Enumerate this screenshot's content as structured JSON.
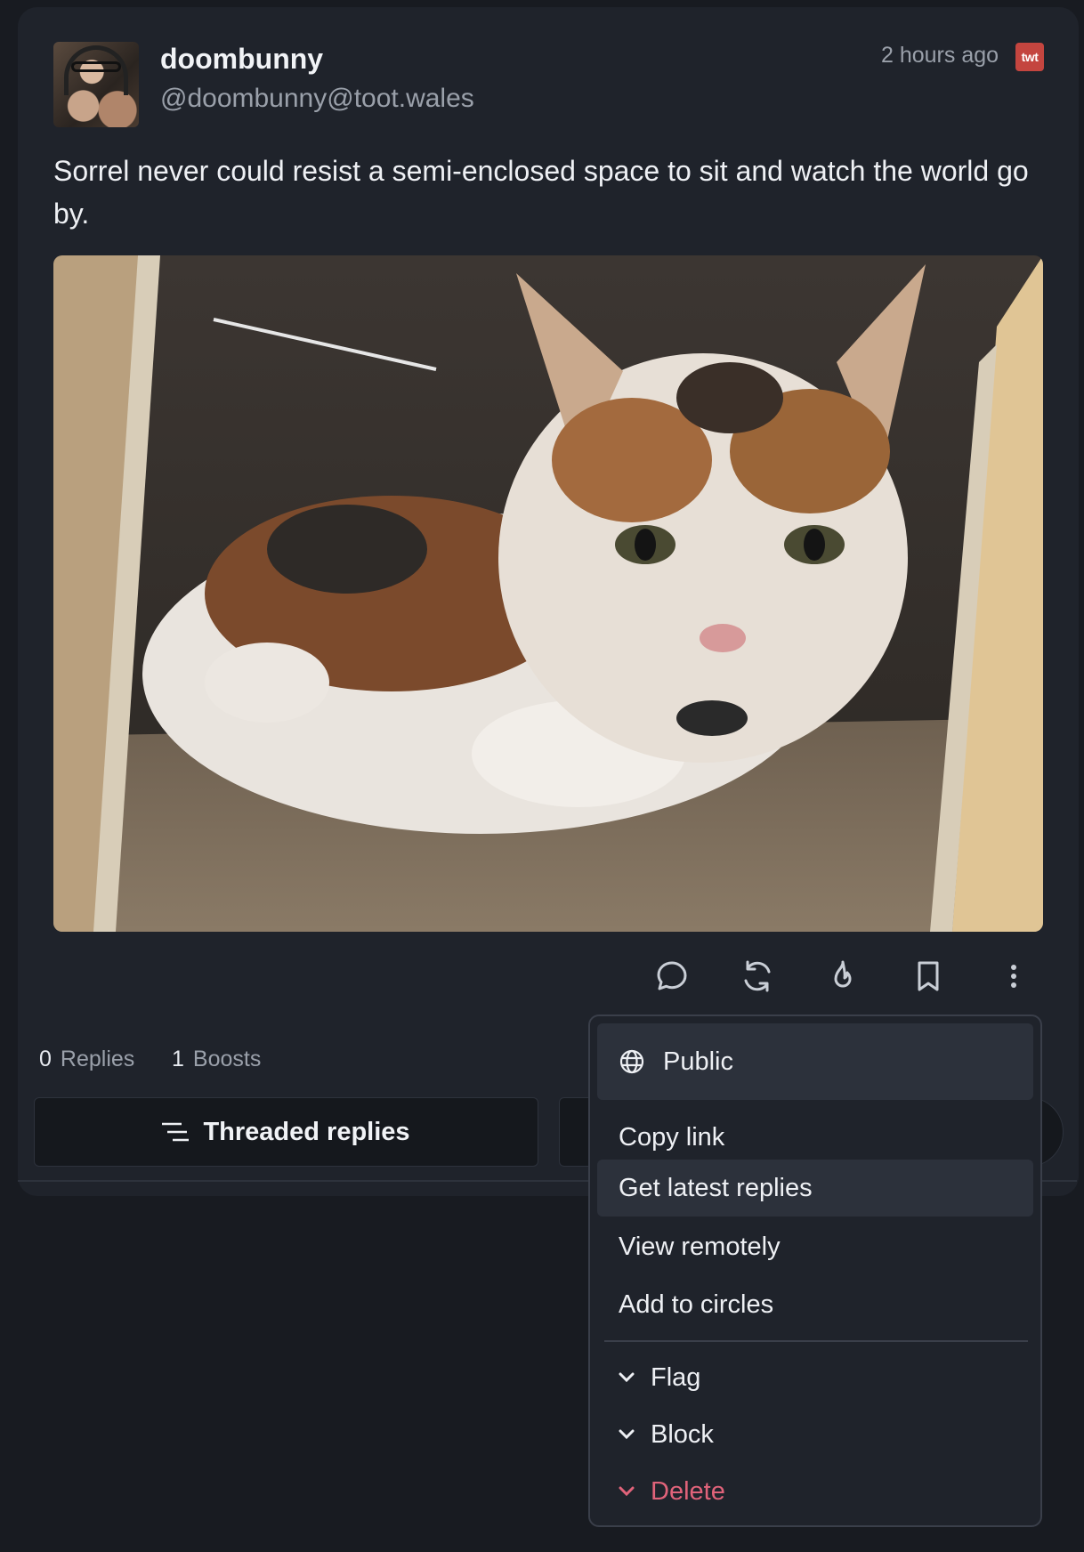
{
  "post": {
    "author_name": "doombunny",
    "author_handle": "@doombunny@toot.wales",
    "timestamp": "2 hours ago",
    "server_badge": "twt",
    "server_badge_color": "#c4453f",
    "text": "Sorrel never could resist a semi-enclosed space to sit and watch the world go by.",
    "image_icon": "cat-in-box-photo"
  },
  "actions": {
    "reply_icon": "speech-bubble-icon",
    "boost_icon": "refresh-icon",
    "favourite_icon": "flame-icon",
    "bookmark_icon": "bookmark-icon",
    "more_icon": "vertical-dots-icon"
  },
  "stats": {
    "replies_count": "0",
    "replies_label": "Replies",
    "boosts_count": "1",
    "boosts_label": "Boosts"
  },
  "tabs": {
    "threaded_label": "Threaded replies"
  },
  "menu": {
    "visibility_label": "Public",
    "copy_link": "Copy link",
    "get_latest": "Get latest replies",
    "view_remotely": "View remotely",
    "add_to_circles": "Add to circles",
    "flag": "Flag",
    "block": "Block",
    "delete": "Delete",
    "danger_color": "#e0637a"
  }
}
